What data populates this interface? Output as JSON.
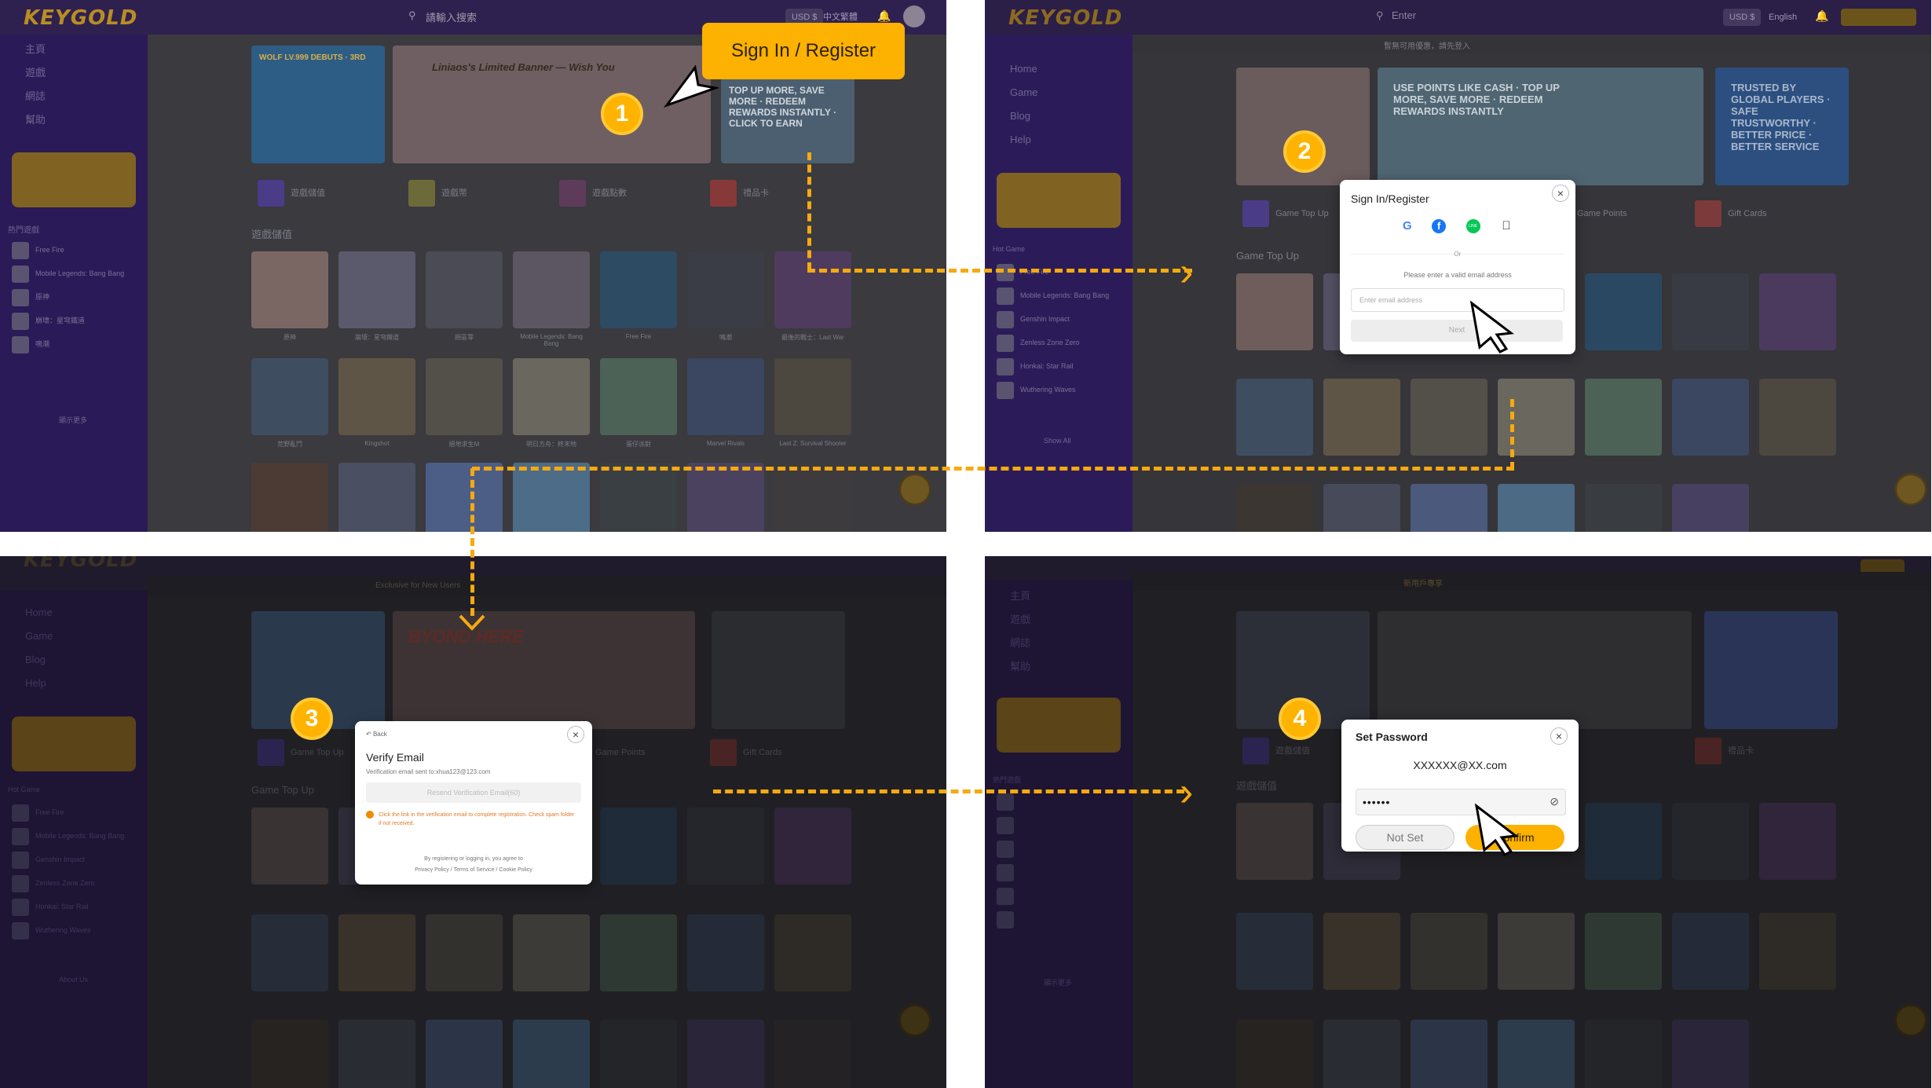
{
  "step1": {
    "logo": "KEYGOLD",
    "search": "請輸入搜索",
    "currency": "USD $",
    "language": "中文繁體",
    "sidebar": [
      "主頁",
      "遊戲",
      "網誌",
      "幫助"
    ],
    "sidebar_section": "熱門遊戲",
    "sidebar_games": [
      "Free Fire",
      "Mobile Legends: Bang Bang",
      "原神",
      "崩壞：星穹鐵道",
      "鳴潮"
    ],
    "sidebar_more": "顯示更多",
    "banners": [
      "WOLF LV.999 DEBUTS · 3RD",
      "Liniaos's Limited Banner — Wish You",
      "TOP UP MORE, SAVE MORE · REDEEM REWARDS INSTANTLY · CLICK TO EARN"
    ],
    "categories": [
      "遊戲儲值",
      "遊戲幣",
      "遊戲點數",
      "禮品卡"
    ],
    "section_title": "遊戲儲值",
    "games_row1": [
      "原神",
      "崩壞：星穹鐵道",
      "絕區零",
      "Mobile Legends: Bang Bang",
      "Free Fire",
      "鳴潮",
      "最後的戰士：Last War"
    ],
    "games_row2": [
      "荒野亂鬥",
      "Kingshot",
      "絕地求生M",
      "明日方舟：終末地",
      "蛋仔派對",
      "Marvel Rivals",
      "Last Z: Survival Shooter"
    ],
    "callout": "Sign In / Register",
    "step_number": "1"
  },
  "step2": {
    "logo": "KEYGOLD",
    "search": "Enter",
    "notice": "暫無可用優惠，請先登入",
    "currency": "USD $",
    "language": "English",
    "sidebar": [
      "Home",
      "Game",
      "Blog",
      "Help"
    ],
    "sidebar_section": "Hot Game",
    "sidebar_games": [
      "Free Fire",
      "Mobile Legends: Bang Bang",
      "Genshin Impact",
      "Zenless Zone Zero",
      "Honkai: Star Rail",
      "Wuthering Waves"
    ],
    "sidebar_more": "Show All",
    "banners": [
      "USE POINTS LIKE CASH · TOP UP MORE, SAVE MORE · REDEEM REWARDS INSTANTLY",
      "TRUSTED BY GLOBAL PLAYERS · SAFE TRUSTWORTHY · BETTER PRICE · BETTER SERVICE"
    ],
    "categories": [
      "Game Top Up",
      "Game Points",
      "Gift Cards"
    ],
    "section_title": "Game Top Up",
    "modal": {
      "title": "Sign In/Register",
      "social": [
        "G",
        "f",
        "LINE",
        "apple"
      ],
      "or": "Or",
      "hint": "Please enter a valid email address",
      "placeholder": "Enter email address",
      "next": "Next"
    },
    "step_number": "2"
  },
  "step3": {
    "logo": "KEYGOLD",
    "notice": "Exclusive for New Users",
    "sidebar": [
      "Home",
      "Game",
      "Blog",
      "Help"
    ],
    "sidebar_section": "Hot Game",
    "sidebar_games": [
      "Free Fire",
      "Mobile Legends: Bang Bang",
      "Genshin Impact",
      "Zenless Zone Zero",
      "Honkai: Star Rail",
      "Wuthering Waves"
    ],
    "sidebar_more": "About Us",
    "categories": [
      "Game Top Up",
      "Game Points",
      "Gift Cards"
    ],
    "section_title": "Game Top Up",
    "banner": "BYOND HERE",
    "modal": {
      "back": "Back",
      "title": "Verify Email",
      "sent": "Verification email sent to:xhua123@123.com",
      "resend": "Resend Verification Email(60)",
      "warning": "Click the link in the verification email to complete registration. Check spam folder if not received.",
      "agree": "By registering or logging in, you agree to",
      "policies": "Privacy Policy / Terms of Service / Cookie Policy"
    },
    "step_number": "3"
  },
  "step4": {
    "logo": "KEYGOLD",
    "notice": "新用戶專享",
    "sidebar": [
      "主頁",
      "遊戲",
      "網誌",
      "幫助"
    ],
    "sidebar_section": "熱門遊戲",
    "sidebar_more": "顯示更多",
    "categories": [
      "遊戲儲值",
      "遊戲幣",
      "遊戲點數",
      "禮品卡"
    ],
    "section_title": "遊戲儲值",
    "modal": {
      "title": "Set Password",
      "email": "XXXXXX@XX.com",
      "password": "••••••",
      "not_set": "Not Set",
      "confirm": "Confirm"
    },
    "step_number": "4"
  },
  "colors": {
    "accent": "#fdb100",
    "sidebar": "#2a1a57",
    "topbar": "#2f214f",
    "dashes": "#f7a910"
  }
}
